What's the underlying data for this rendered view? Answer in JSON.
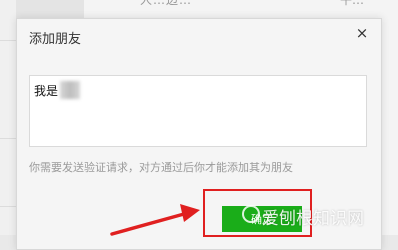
{
  "background": {
    "top_text_left": "人…边…",
    "top_text_right": "午…"
  },
  "dialog": {
    "title": "添加朋友",
    "close_icon": "×",
    "message_prefix": "我是",
    "hint": "你需要发送验证请求，对方通过后你才能添加其为朋友",
    "confirm_label": "确定"
  },
  "annotation": {
    "highlight_color": "#e02020",
    "arrow_color": "#e02020"
  },
  "watermark": {
    "text": "爱刨根知识网"
  }
}
